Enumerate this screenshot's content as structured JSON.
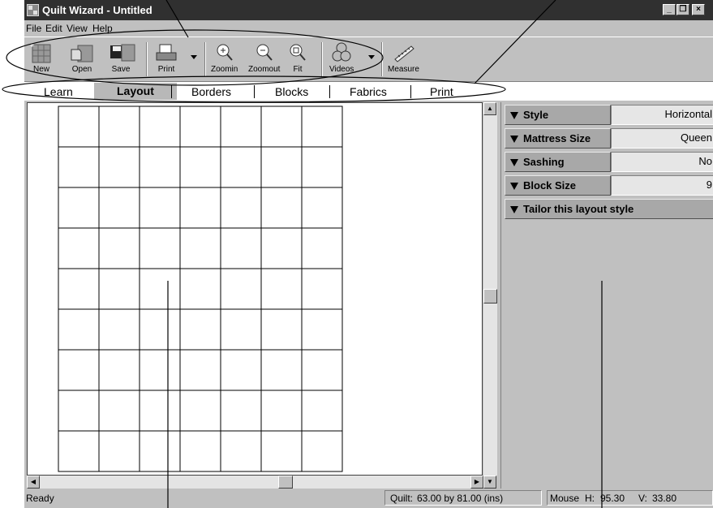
{
  "window": {
    "title": "Quilt Wizard - Untitled"
  },
  "menu": [
    "File",
    "Edit",
    "View",
    "Help"
  ],
  "toolbar": {
    "new": "New",
    "open": "Open",
    "save": "Save",
    "print": "Print",
    "zoomin": "Zoomin",
    "zoomout": "Zoomout",
    "fit": "Fit",
    "videos": "Videos",
    "measure": "Measure"
  },
  "tabs": [
    "Learn",
    "Layout",
    "Borders",
    "Blocks",
    "Fabrics",
    "Print"
  ],
  "active_tab": "Layout",
  "quilt_grid": {
    "columns": 7,
    "rows": 9
  },
  "properties": [
    {
      "label": "Style",
      "value": "Horizontal"
    },
    {
      "label": "Mattress Size",
      "value": "Queen"
    },
    {
      "label": "Sashing",
      "value": "No"
    },
    {
      "label": "Block Size",
      "value": "9"
    },
    {
      "label": "Tailor this layout style"
    }
  ],
  "status": {
    "ready": "Ready",
    "quilt_label": "Quilt:",
    "quilt_value": "63.00 by 81.00 (ins)",
    "mouse_label": "Mouse",
    "h_label": "H:",
    "h_value": "95.30",
    "v_label": "V:",
    "v_value": "33.80"
  }
}
